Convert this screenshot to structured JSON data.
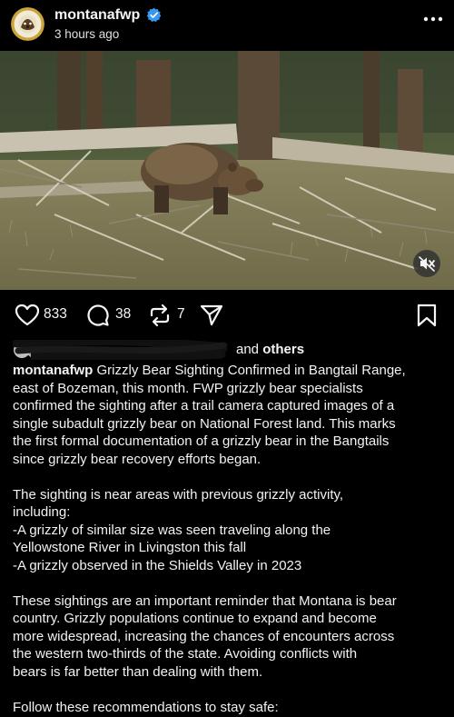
{
  "post": {
    "username": "montanafwp",
    "timestamp": "3 hours ago",
    "avatar": "fwp-logo",
    "verified_badge": "verified-icon",
    "more_menu": "more-icon"
  },
  "actions": {
    "likes": "833",
    "comments": "38",
    "reposts": "7",
    "icons": [
      "heart-icon",
      "comment-icon",
      "repost-icon",
      "share-icon",
      "bookmark-icon"
    ]
  },
  "liked_by": {
    "suffix_1": "and ",
    "others": "others"
  },
  "caption": {
    "author": "montanafwp",
    "p1": [
      " Grizzly Bear Sighting Confirmed in Bangtail Range,",
      "east of Bozeman, this month. FWP grizzly bear specialists",
      "confirmed the sighting after a trail camera captured images of a",
      "single subadult grizzly bear on National Forest land. This marks",
      "the first formal documentation of a grizzly bear in the Bangtails",
      "since grizzly bear recovery efforts began."
    ],
    "p2": [
      "The sighting is near areas with previous grizzly activity,",
      "including:",
      "-A grizzly of similar size was seen traveling along the",
      "Yellowstone River in Livingston this fall",
      "-A grizzly observed in the Shields Valley in 2023"
    ],
    "p3": [
      "These sightings are an important reminder that Montana is bear",
      "country. Grizzly populations continue to expand and become",
      "more widespread, increasing the chances of encounters across",
      "the western two-thirds of the state. Avoiding conflicts with",
      "bears is far better than dealing with them."
    ],
    "p4": [
      "Follow these recommendations to stay safe:"
    ]
  },
  "colors": {
    "background": "#000000",
    "text": "#f5f5f5",
    "verified": "#3897f0"
  }
}
